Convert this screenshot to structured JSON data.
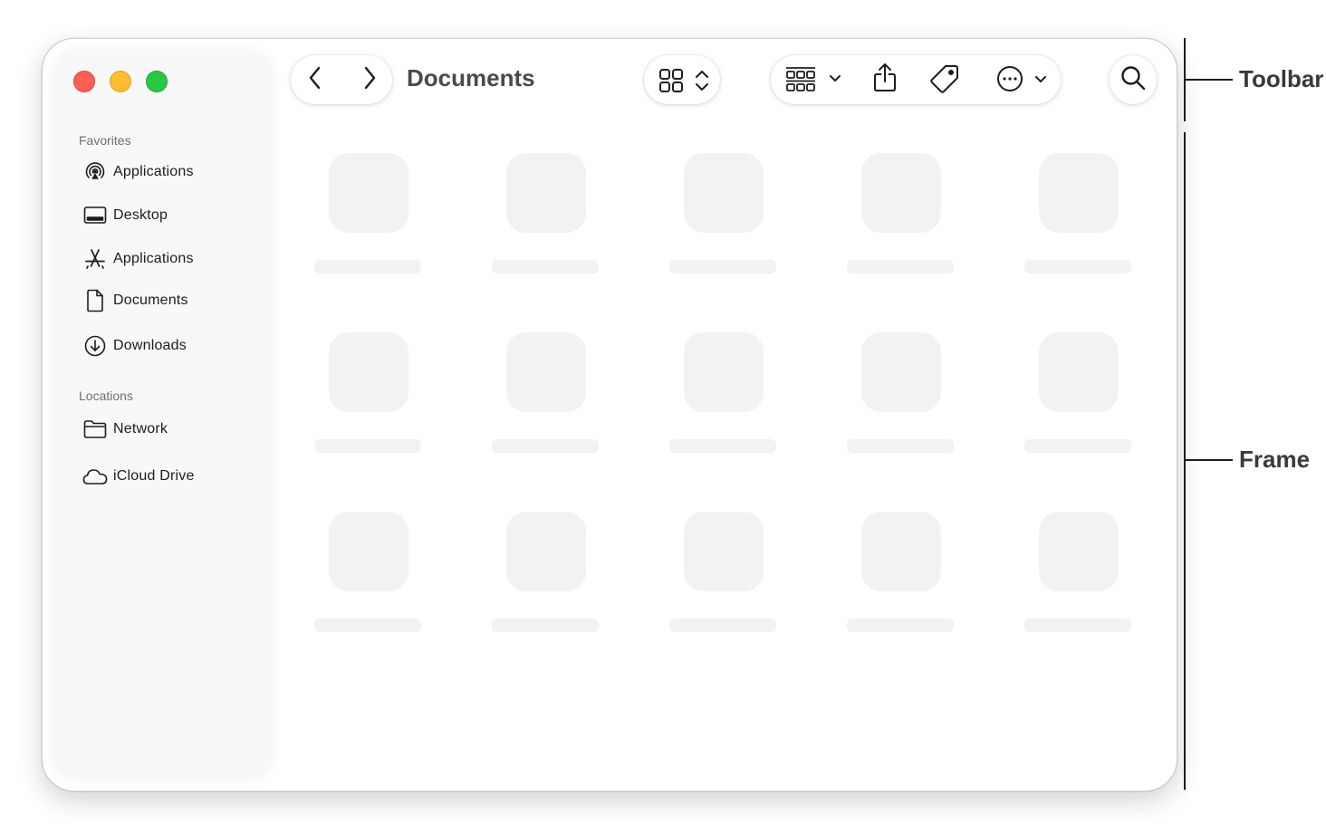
{
  "window": {
    "title": "Documents"
  },
  "sidebar": {
    "sections": [
      {
        "label": "Favorites",
        "items": [
          {
            "label": "Applications",
            "icon": "airdrop-icon"
          },
          {
            "label": "Desktop",
            "icon": "desktop-icon"
          },
          {
            "label": "Applications",
            "icon": "app-store-icon"
          },
          {
            "label": "Documents",
            "icon": "document-icon"
          },
          {
            "label": "Downloads",
            "icon": "download-icon"
          }
        ]
      },
      {
        "label": "Locations",
        "items": [
          {
            "label": "Network",
            "icon": "folder-icon"
          },
          {
            "label": "iCloud Drive",
            "icon": "cloud-icon"
          }
        ]
      }
    ]
  },
  "toolbar": {
    "buttons": [
      "back-icon",
      "forward-icon",
      "grid-view-icon",
      "group-icon",
      "share-icon",
      "tag-icon",
      "more-icon",
      "search-icon"
    ]
  },
  "content": {
    "rows": 3,
    "columns": 5,
    "placeholder_color": "#f2f2f2"
  },
  "annotations": {
    "toolbar": "Toolbar",
    "frame": "Frame"
  },
  "colors": {
    "close": "#ff5f57",
    "minimize": "#febc2e",
    "zoom": "#28c840"
  }
}
